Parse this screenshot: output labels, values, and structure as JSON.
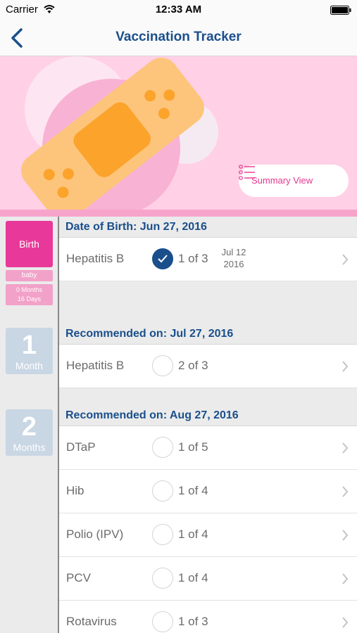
{
  "status": {
    "carrier": "Carrier",
    "time": "12:33 AM"
  },
  "nav": {
    "title": "Vaccination Tracker"
  },
  "banner": {
    "summary_label": "Summary View"
  },
  "timeline": {
    "birth_label": "Birth",
    "baby_tag": "baby",
    "age_line1": "0 Months",
    "age_line2": "16 Days",
    "month1": {
      "num": "1",
      "unit": "Month"
    },
    "month2": {
      "num": "2",
      "unit": "Months"
    }
  },
  "sections": [
    {
      "title": "Date of Birth: Jun 27, 2016",
      "rows": [
        {
          "name": "Hepatitis B",
          "dose": "1 of 3",
          "done": true,
          "date_line1": "Jul 12",
          "date_line2": "2016"
        }
      ]
    },
    {
      "title": "Recommended on: Jul 27, 2016",
      "rows": [
        {
          "name": "Hepatitis B",
          "dose": "2 of 3",
          "done": false
        }
      ]
    },
    {
      "title": "Recommended on: Aug 27, 2016",
      "rows": [
        {
          "name": "DTaP",
          "dose": "1 of 5",
          "done": false
        },
        {
          "name": "Hib",
          "dose": "1 of 4",
          "done": false
        },
        {
          "name": "Polio (IPV)",
          "dose": "1 of 4",
          "done": false
        },
        {
          "name": "PCV",
          "dose": "1 of 4",
          "done": false
        },
        {
          "name": "Rotavirus",
          "dose": "1 of 3",
          "done": false
        }
      ]
    }
  ],
  "colors": {
    "accent": "#1a4f8c",
    "pink": "#e8399a",
    "banner_bg": "#ffd0e6",
    "bandage": "#fdc57b"
  },
  "icons": [
    "wifi-icon",
    "battery-icon",
    "back-chevron-icon",
    "list-icon",
    "bandage-icon",
    "checkmark-icon",
    "chevron-right-icon"
  ]
}
